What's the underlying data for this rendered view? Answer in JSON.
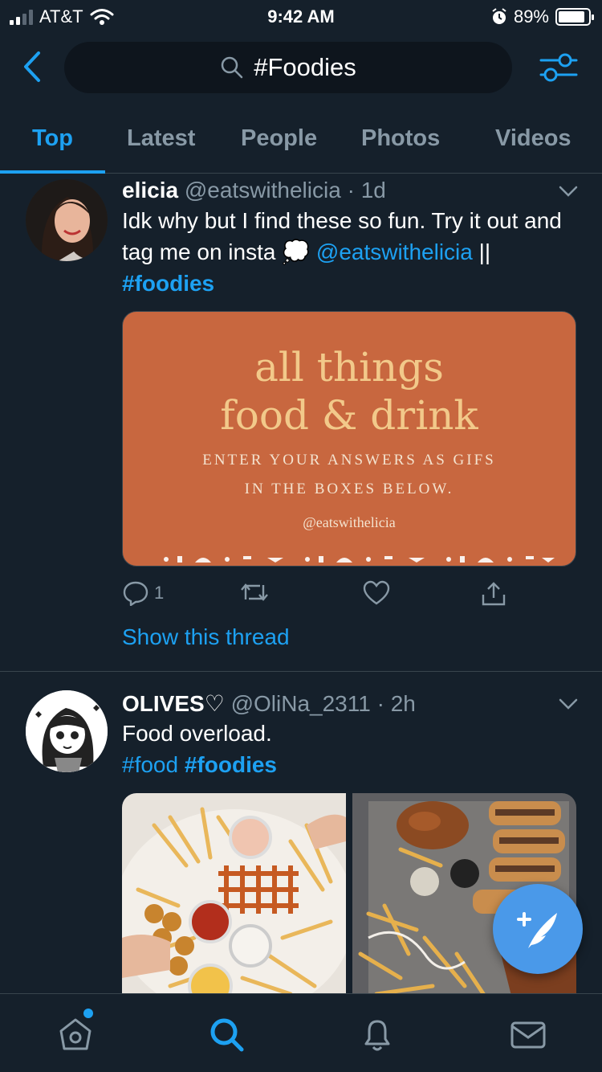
{
  "status_bar": {
    "carrier": "AT&T",
    "time": "9:42 AM",
    "battery": "89%",
    "battery_level": 0.89
  },
  "search": {
    "query": "#Foodies"
  },
  "tabs": [
    {
      "label": "Top",
      "active": true
    },
    {
      "label": "Latest",
      "active": false
    },
    {
      "label": "People",
      "active": false
    },
    {
      "label": "Photos",
      "active": false
    },
    {
      "label": "Videos",
      "active": false
    }
  ],
  "tweets": [
    {
      "name": "elicia",
      "handle": "@eatswithelicia",
      "sep": "·",
      "time": "1d",
      "text_before": "Idk why but I find these so fun. Try it out and tag me on insta",
      "emoji": "💭",
      "mention": "@eatswithelicia",
      "text_sep": "||",
      "hashtag": "#foodies",
      "card": {
        "line1": "all things",
        "line2": "food & drink",
        "sub1": "ENTER YOUR ANSWERS AS GIFS",
        "sub2": "IN THE BOXES BELOW.",
        "handle": "@eatswithelicia"
      },
      "reply_count": "1",
      "show_thread": "Show this thread"
    },
    {
      "name": "OLIVES♡",
      "handle": "@OliNa_2311",
      "sep": "·",
      "time": "2h",
      "text": "Food overload.",
      "hashtag1": "#food",
      "hashtag2": "#foodies"
    }
  ],
  "colors": {
    "background": "#15202b",
    "accent": "#1da1f2",
    "muted": "#8899a6",
    "card_orange": "#c8673f",
    "fab": "#4a99e9"
  },
  "icons": {
    "back": "chevron-left-icon",
    "search": "search-icon",
    "filter": "sliders-icon",
    "reply": "comment-icon",
    "retweet": "retweet-icon",
    "like": "heart-icon",
    "share": "share-icon",
    "compose": "compose-tweet-icon",
    "home": "home-icon",
    "explore": "search-icon",
    "notifications": "bell-icon",
    "messages": "mail-icon"
  }
}
